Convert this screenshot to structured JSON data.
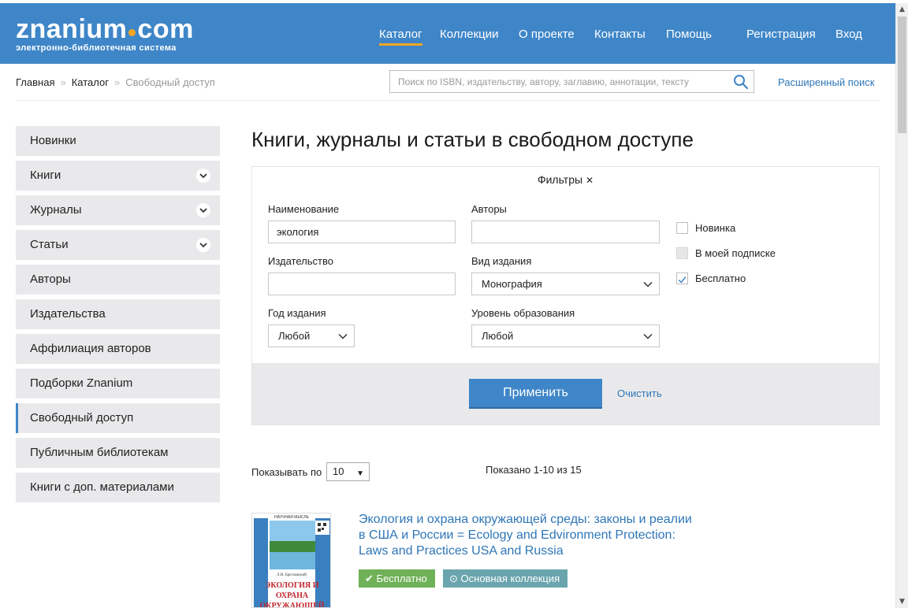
{
  "header": {
    "logo_main_left": "znanium",
    "logo_main_right": "com",
    "logo_subtitle": "электронно-библиотечная система",
    "nav": [
      "Каталог",
      "Коллекции",
      "О проекте",
      "Контакты",
      "Помощь",
      "Регистрация",
      "Вход"
    ],
    "active_nav": "Каталог",
    "accent_color": "#f5a623",
    "header_color": "#3f86c8"
  },
  "breadcrumb": {
    "items": [
      "Главная",
      "Каталог",
      "Свободный доступ"
    ]
  },
  "search": {
    "placeholder": "Поиск по ISBN, издательству, автору, заглавию, аннотации, тексту",
    "advanced_label": "Расширенный поиск"
  },
  "sidebar": {
    "items": [
      {
        "label": "Новинки",
        "expandable": false
      },
      {
        "label": "Книги",
        "expandable": true
      },
      {
        "label": "Журналы",
        "expandable": true
      },
      {
        "label": "Статьи",
        "expandable": true
      },
      {
        "label": "Авторы",
        "expandable": false
      },
      {
        "label": "Издательства",
        "expandable": false
      },
      {
        "label": "Аффилиация авторов",
        "expandable": false
      },
      {
        "label": "Подборки Znanium",
        "expandable": false
      },
      {
        "label": "Свободный доступ",
        "expandable": false,
        "active": true
      },
      {
        "label": "Публичным библиотекам",
        "expandable": false
      },
      {
        "label": "Книги с доп. материалами",
        "expandable": false
      }
    ]
  },
  "main": {
    "title": "Книги, журналы и статьи в свободном доступе"
  },
  "filters": {
    "title": "Фильтры",
    "close_glyph": "✕",
    "name_label": "Наименование",
    "name_value": "экология",
    "authors_label": "Авторы",
    "authors_value": "",
    "publisher_label": "Издательство",
    "publisher_value": "",
    "edition_type_label": "Вид издания",
    "edition_type_value": "Монография",
    "year_label": "Год издания",
    "year_value": "Любой",
    "edu_level_label": "Уровень образования",
    "edu_level_value": "Любой",
    "checkboxes": [
      {
        "label": "Новинка",
        "checked": false,
        "disabled": false
      },
      {
        "label": "В моей подписке",
        "checked": false,
        "disabled": true
      },
      {
        "label": "Бесплатно",
        "checked": true,
        "disabled": false
      }
    ],
    "apply_label": "Применить",
    "clear_label": "Очистить"
  },
  "results": {
    "per_page_label": "Показывать по",
    "per_page_value": "10",
    "shown_text": "Показано 1-10 из 15"
  },
  "book": {
    "title": "Экология и охрана окружающей среды: законы и реалии в США и России = Ecology and Edvironment Protection: Laws and Practices USA and Russia",
    "cover_series": "НАУЧНАЯ МЫСЛЬ",
    "cover_author": "Л.Н. Бреславский",
    "cover_title": "ЭКОЛОГИЯ И ОХРАНА ОКРУЖАЮЩЕЙ СРЕДЫ",
    "badge_free": "Бесплатно",
    "badge_collection": "Основная коллекция",
    "badge_free_color": "#6fb157",
    "badge_collection_color": "#6aa5ae"
  }
}
